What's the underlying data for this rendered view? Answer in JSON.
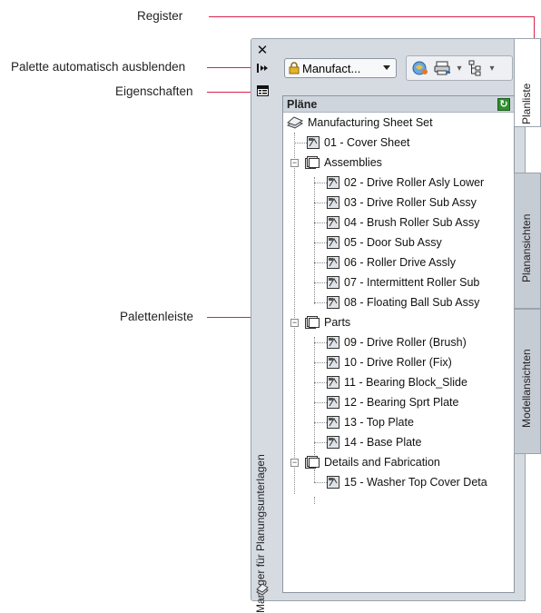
{
  "callouts": {
    "register": "Register",
    "auto_hide": "Palette automatisch ausblenden",
    "properties": "Eigenschaften",
    "palette_bar": "Palettenleiste"
  },
  "palette_strip": {
    "close_glyph": "✕",
    "title": "Manager für Planungsunterlagen"
  },
  "toolbar": {
    "sheet_set_value": "Manufact..."
  },
  "panel": {
    "header": "Pläne",
    "root": "Manufacturing Sheet Set",
    "items": [
      {
        "label": "01 - Cover Sheet",
        "type": "sheet",
        "level": 1
      },
      {
        "label": "Assemblies",
        "type": "group",
        "level": 1
      },
      {
        "label": "02 - Drive Roller Asly Lower",
        "type": "sheet",
        "level": 2
      },
      {
        "label": "03 - Drive Roller Sub Assy",
        "type": "sheet",
        "level": 2
      },
      {
        "label": "04 - Brush Roller Sub Assy",
        "type": "sheet",
        "level": 2
      },
      {
        "label": "05 - Door Sub Assy",
        "type": "sheet",
        "level": 2
      },
      {
        "label": "06 - Roller Drive Assly",
        "type": "sheet",
        "level": 2
      },
      {
        "label": "07 - Intermittent Roller Sub",
        "type": "sheet",
        "level": 2
      },
      {
        "label": "08 - Floating Ball Sub Assy",
        "type": "sheet",
        "level": 2
      },
      {
        "label": "Parts",
        "type": "group",
        "level": 1
      },
      {
        "label": "09 - Drive Roller (Brush)",
        "type": "sheet",
        "level": 2
      },
      {
        "label": "10 - Drive Roller (Fix)",
        "type": "sheet",
        "level": 2
      },
      {
        "label": "11 - Bearing Block_Slide",
        "type": "sheet",
        "level": 2
      },
      {
        "label": "12 - Bearing Sprt Plate",
        "type": "sheet",
        "level": 2
      },
      {
        "label": "13 - Top Plate",
        "type": "sheet",
        "level": 2
      },
      {
        "label": "14 - Base Plate",
        "type": "sheet",
        "level": 2
      },
      {
        "label": "Details and Fabrication",
        "type": "group",
        "level": 1
      },
      {
        "label": "15 - Washer Top Cover Deta",
        "type": "sheet",
        "level": 2
      }
    ]
  },
  "tabs": [
    {
      "label": "Planliste",
      "active": true
    },
    {
      "label": "Planansichten",
      "active": false
    },
    {
      "label": "Modellansichten",
      "active": false
    }
  ],
  "colors": {
    "callout_line": "#d8224a",
    "palette_bg": "#d6dbe2"
  }
}
